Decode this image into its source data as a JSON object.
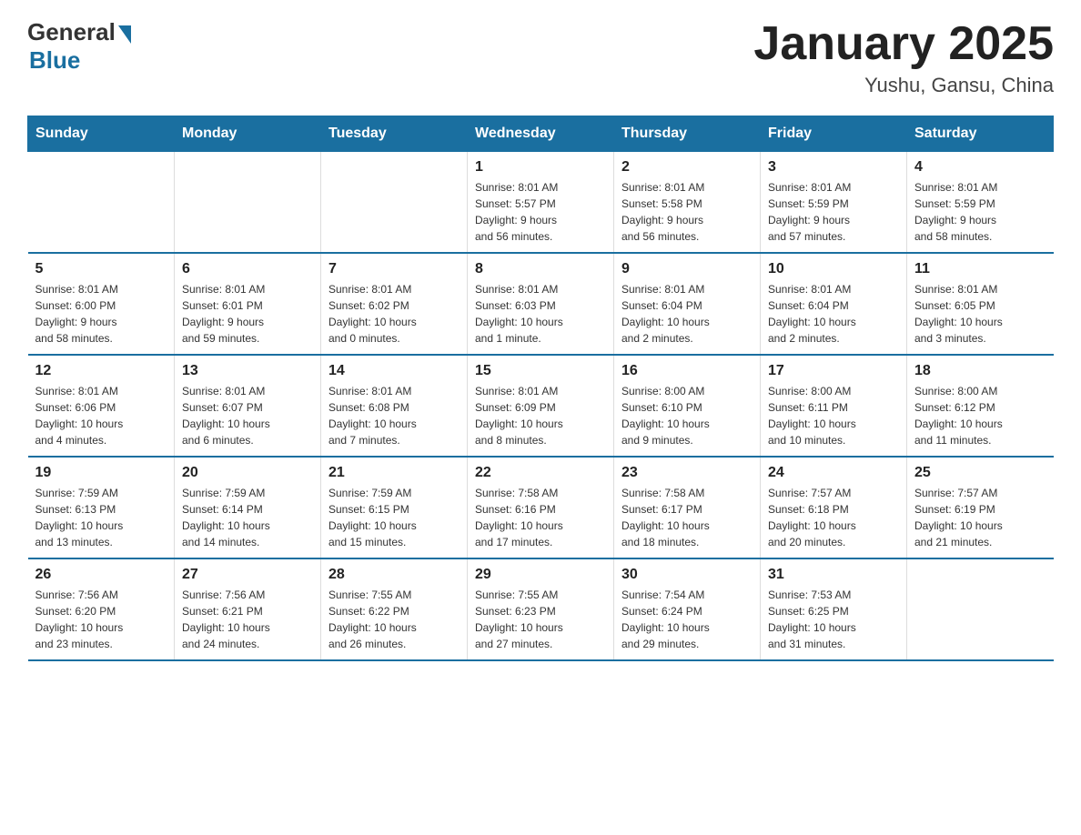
{
  "logo": {
    "general": "General",
    "blue": "Blue"
  },
  "title": "January 2025",
  "location": "Yushu, Gansu, China",
  "days_of_week": [
    "Sunday",
    "Monday",
    "Tuesday",
    "Wednesday",
    "Thursday",
    "Friday",
    "Saturday"
  ],
  "weeks": [
    [
      {
        "day": "",
        "info": ""
      },
      {
        "day": "",
        "info": ""
      },
      {
        "day": "",
        "info": ""
      },
      {
        "day": "1",
        "info": "Sunrise: 8:01 AM\nSunset: 5:57 PM\nDaylight: 9 hours\nand 56 minutes."
      },
      {
        "day": "2",
        "info": "Sunrise: 8:01 AM\nSunset: 5:58 PM\nDaylight: 9 hours\nand 56 minutes."
      },
      {
        "day": "3",
        "info": "Sunrise: 8:01 AM\nSunset: 5:59 PM\nDaylight: 9 hours\nand 57 minutes."
      },
      {
        "day": "4",
        "info": "Sunrise: 8:01 AM\nSunset: 5:59 PM\nDaylight: 9 hours\nand 58 minutes."
      }
    ],
    [
      {
        "day": "5",
        "info": "Sunrise: 8:01 AM\nSunset: 6:00 PM\nDaylight: 9 hours\nand 58 minutes."
      },
      {
        "day": "6",
        "info": "Sunrise: 8:01 AM\nSunset: 6:01 PM\nDaylight: 9 hours\nand 59 minutes."
      },
      {
        "day": "7",
        "info": "Sunrise: 8:01 AM\nSunset: 6:02 PM\nDaylight: 10 hours\nand 0 minutes."
      },
      {
        "day": "8",
        "info": "Sunrise: 8:01 AM\nSunset: 6:03 PM\nDaylight: 10 hours\nand 1 minute."
      },
      {
        "day": "9",
        "info": "Sunrise: 8:01 AM\nSunset: 6:04 PM\nDaylight: 10 hours\nand 2 minutes."
      },
      {
        "day": "10",
        "info": "Sunrise: 8:01 AM\nSunset: 6:04 PM\nDaylight: 10 hours\nand 2 minutes."
      },
      {
        "day": "11",
        "info": "Sunrise: 8:01 AM\nSunset: 6:05 PM\nDaylight: 10 hours\nand 3 minutes."
      }
    ],
    [
      {
        "day": "12",
        "info": "Sunrise: 8:01 AM\nSunset: 6:06 PM\nDaylight: 10 hours\nand 4 minutes."
      },
      {
        "day": "13",
        "info": "Sunrise: 8:01 AM\nSunset: 6:07 PM\nDaylight: 10 hours\nand 6 minutes."
      },
      {
        "day": "14",
        "info": "Sunrise: 8:01 AM\nSunset: 6:08 PM\nDaylight: 10 hours\nand 7 minutes."
      },
      {
        "day": "15",
        "info": "Sunrise: 8:01 AM\nSunset: 6:09 PM\nDaylight: 10 hours\nand 8 minutes."
      },
      {
        "day": "16",
        "info": "Sunrise: 8:00 AM\nSunset: 6:10 PM\nDaylight: 10 hours\nand 9 minutes."
      },
      {
        "day": "17",
        "info": "Sunrise: 8:00 AM\nSunset: 6:11 PM\nDaylight: 10 hours\nand 10 minutes."
      },
      {
        "day": "18",
        "info": "Sunrise: 8:00 AM\nSunset: 6:12 PM\nDaylight: 10 hours\nand 11 minutes."
      }
    ],
    [
      {
        "day": "19",
        "info": "Sunrise: 7:59 AM\nSunset: 6:13 PM\nDaylight: 10 hours\nand 13 minutes."
      },
      {
        "day": "20",
        "info": "Sunrise: 7:59 AM\nSunset: 6:14 PM\nDaylight: 10 hours\nand 14 minutes."
      },
      {
        "day": "21",
        "info": "Sunrise: 7:59 AM\nSunset: 6:15 PM\nDaylight: 10 hours\nand 15 minutes."
      },
      {
        "day": "22",
        "info": "Sunrise: 7:58 AM\nSunset: 6:16 PM\nDaylight: 10 hours\nand 17 minutes."
      },
      {
        "day": "23",
        "info": "Sunrise: 7:58 AM\nSunset: 6:17 PM\nDaylight: 10 hours\nand 18 minutes."
      },
      {
        "day": "24",
        "info": "Sunrise: 7:57 AM\nSunset: 6:18 PM\nDaylight: 10 hours\nand 20 minutes."
      },
      {
        "day": "25",
        "info": "Sunrise: 7:57 AM\nSunset: 6:19 PM\nDaylight: 10 hours\nand 21 minutes."
      }
    ],
    [
      {
        "day": "26",
        "info": "Sunrise: 7:56 AM\nSunset: 6:20 PM\nDaylight: 10 hours\nand 23 minutes."
      },
      {
        "day": "27",
        "info": "Sunrise: 7:56 AM\nSunset: 6:21 PM\nDaylight: 10 hours\nand 24 minutes."
      },
      {
        "day": "28",
        "info": "Sunrise: 7:55 AM\nSunset: 6:22 PM\nDaylight: 10 hours\nand 26 minutes."
      },
      {
        "day": "29",
        "info": "Sunrise: 7:55 AM\nSunset: 6:23 PM\nDaylight: 10 hours\nand 27 minutes."
      },
      {
        "day": "30",
        "info": "Sunrise: 7:54 AM\nSunset: 6:24 PM\nDaylight: 10 hours\nand 29 minutes."
      },
      {
        "day": "31",
        "info": "Sunrise: 7:53 AM\nSunset: 6:25 PM\nDaylight: 10 hours\nand 31 minutes."
      },
      {
        "day": "",
        "info": ""
      }
    ]
  ]
}
